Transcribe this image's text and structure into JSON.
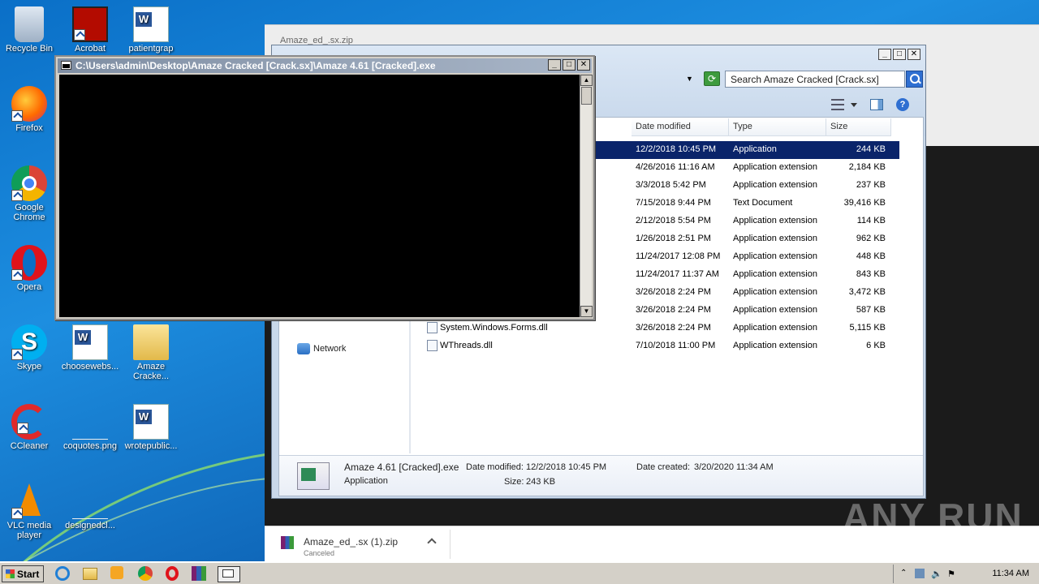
{
  "desktop_icons": [
    {
      "label": "Recycle Bin"
    },
    {
      "label": "Acrobat"
    },
    {
      "label": "patientgrap"
    },
    {
      "label": "Firefox"
    },
    {
      "label": "Google Chrome"
    },
    {
      "label": "Opera"
    },
    {
      "label": "Skype"
    },
    {
      "label": "choosewebs..."
    },
    {
      "label": "Amaze Cracke..."
    },
    {
      "label": "CCleaner"
    },
    {
      "label": "coquotes.png"
    },
    {
      "label": "wrotepublic..."
    },
    {
      "label": "VLC media player"
    },
    {
      "label": "designedcl..."
    }
  ],
  "console": {
    "title": "C:\\Users\\admin\\Desktop\\Amaze Cracked [Crack.sx]\\Amaze 4.61 [Cracked].exe"
  },
  "explorer": {
    "ghost_title": "Amaze_ed_.sx.zip",
    "search_placeholder": "Search Amaze Cracked [Crack.sx]",
    "columns": {
      "date": "Date modified",
      "type": "Type",
      "size": "Size"
    },
    "nav_network": "Network",
    "files": [
      {
        "name": "",
        "date": "12/2/2018 10:45 PM",
        "type": "Application",
        "size": "244 KB",
        "selected": true
      },
      {
        "name": "",
        "date": "4/26/2016 11:16 AM",
        "type": "Application extension",
        "size": "2,184 KB"
      },
      {
        "name": "",
        "date": "3/3/2018 5:42 PM",
        "type": "Application extension",
        "size": "237 KB"
      },
      {
        "name": "",
        "date": "7/15/2018 9:44 PM",
        "type": "Text Document",
        "size": "39,416 KB"
      },
      {
        "name": "",
        "date": "2/12/2018 5:54 PM",
        "type": "Application extension",
        "size": "114 KB"
      },
      {
        "name": "",
        "date": "1/26/2018 2:51 PM",
        "type": "Application extension",
        "size": "962 KB"
      },
      {
        "name": "",
        "date": "11/24/2017 12:08 PM",
        "type": "Application extension",
        "size": "448 KB"
      },
      {
        "name": "",
        "date": "11/24/2017 11:37 AM",
        "type": "Application extension",
        "size": "843 KB"
      },
      {
        "name": "",
        "date": "3/26/2018 2:24 PM",
        "type": "Application extension",
        "size": "3,472 KB"
      },
      {
        "name": "",
        "date": "3/26/2018 2:24 PM",
        "type": "Application extension",
        "size": "587 KB"
      },
      {
        "name": "System.Windows.Forms.dll",
        "date": "3/26/2018 2:24 PM",
        "type": "Application extension",
        "size": "5,115 KB"
      },
      {
        "name": "WThreads.dll",
        "date": "7/10/2018 11:00 PM",
        "type": "Application extension",
        "size": "6 KB"
      }
    ],
    "details": {
      "filename": "Amaze 4.61 [Cracked].exe",
      "kind": "Application",
      "modified_label": "Date modified:",
      "modified_value": "12/2/2018 10:45 PM",
      "size_label": "Size:",
      "size_value": "243 KB",
      "created_label": "Date created:",
      "created_value": "3/20/2020 11:34 AM"
    }
  },
  "download": {
    "filename": "Amaze_ed_.sx (1).zip",
    "status": "Canceled"
  },
  "taskbar": {
    "start_label": "Start",
    "clock": "11:34 AM"
  },
  "watermark": "ANY RUN"
}
